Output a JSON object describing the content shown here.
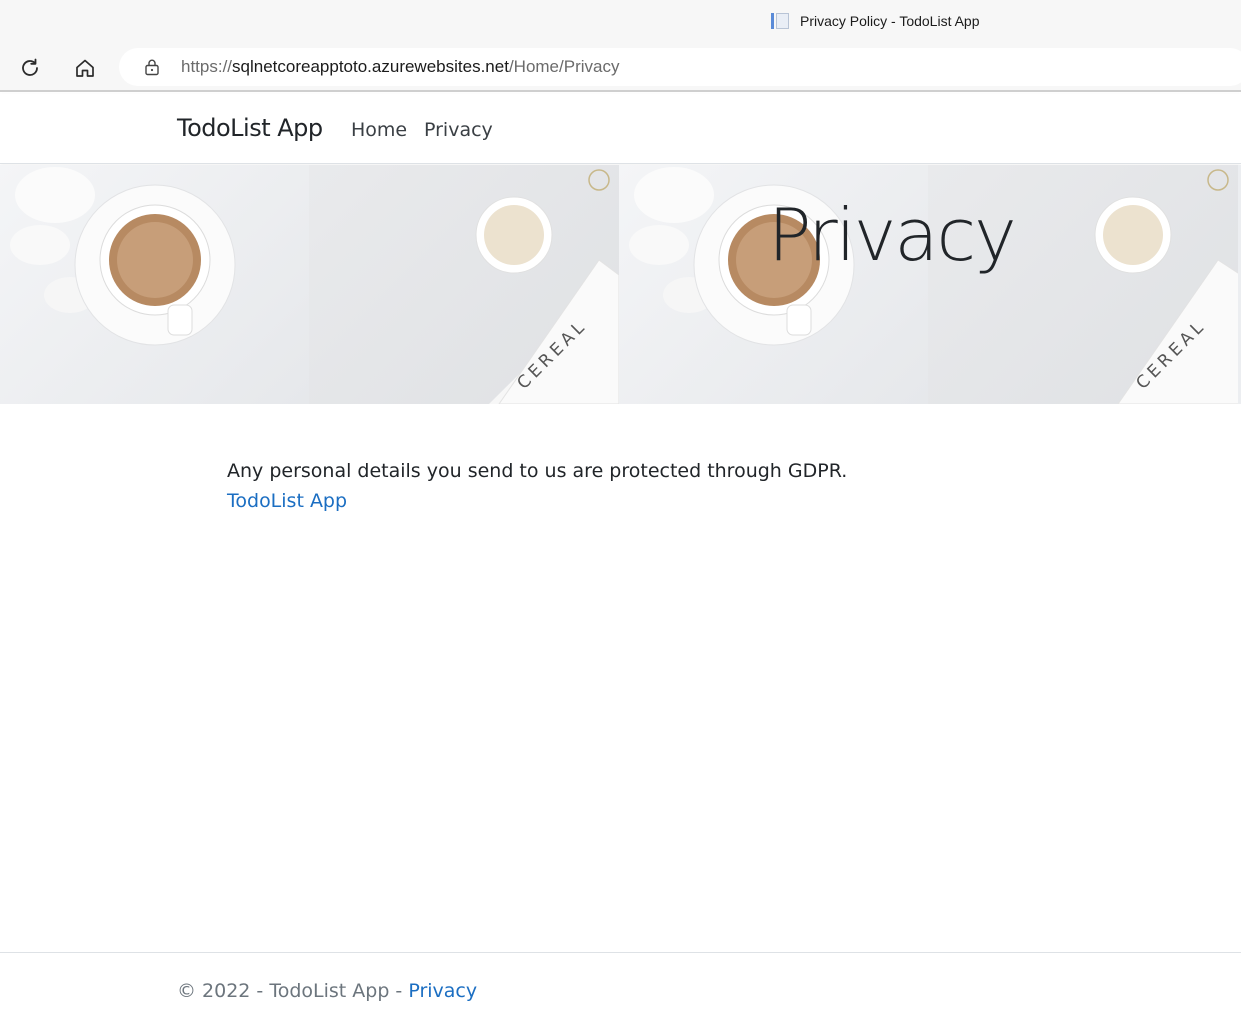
{
  "browser": {
    "tab_title": "Privacy Policy - TodoList App",
    "url_scheme": "https://",
    "url_host": "sqlnetcoreapptoto.azurewebsites.net",
    "url_path": "/Home/Privacy"
  },
  "navbar": {
    "brand": "TodoList App",
    "links": [
      {
        "label": "Home"
      },
      {
        "label": "Privacy"
      }
    ]
  },
  "hero": {
    "title": "Privacy",
    "image_text": "CEREAL"
  },
  "main": {
    "message": "Any personal details you send to us are protected through GDPR.",
    "link_label": "TodoList App"
  },
  "footer": {
    "copyright": "© 2022 - TodoList App - ",
    "privacy_link": "Privacy"
  },
  "colors": {
    "link": "#1b6ec2",
    "text": "#212529",
    "muted": "#6c757d",
    "chrome_bg": "#f7f7f7"
  }
}
